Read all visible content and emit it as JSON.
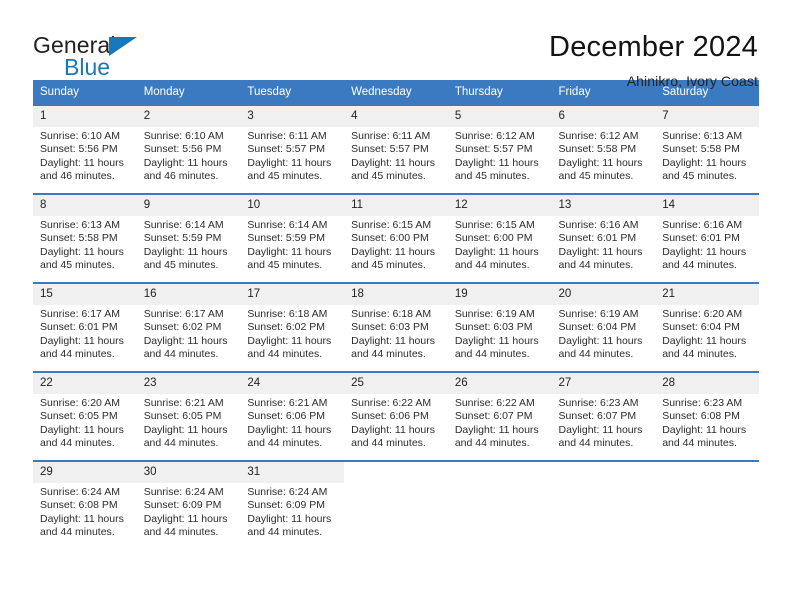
{
  "brand": {
    "name_part1": "General",
    "name_part2": "Blue",
    "accent_color": "#1878be"
  },
  "header": {
    "title": "December 2024",
    "subtitle": "Ahinikro, Ivory Coast"
  },
  "calendar": {
    "header_bg": "#3b7ac1",
    "daynum_bg": "#f0f0f0",
    "weekdays": [
      "Sunday",
      "Monday",
      "Tuesday",
      "Wednesday",
      "Thursday",
      "Friday",
      "Saturday"
    ],
    "weeks": [
      [
        {
          "day": "1",
          "sunrise": "Sunrise: 6:10 AM",
          "sunset": "Sunset: 5:56 PM",
          "daylight_1": "Daylight: 11 hours",
          "daylight_2": "and 46 minutes."
        },
        {
          "day": "2",
          "sunrise": "Sunrise: 6:10 AM",
          "sunset": "Sunset: 5:56 PM",
          "daylight_1": "Daylight: 11 hours",
          "daylight_2": "and 46 minutes."
        },
        {
          "day": "3",
          "sunrise": "Sunrise: 6:11 AM",
          "sunset": "Sunset: 5:57 PM",
          "daylight_1": "Daylight: 11 hours",
          "daylight_2": "and 45 minutes."
        },
        {
          "day": "4",
          "sunrise": "Sunrise: 6:11 AM",
          "sunset": "Sunset: 5:57 PM",
          "daylight_1": "Daylight: 11 hours",
          "daylight_2": "and 45 minutes."
        },
        {
          "day": "5",
          "sunrise": "Sunrise: 6:12 AM",
          "sunset": "Sunset: 5:57 PM",
          "daylight_1": "Daylight: 11 hours",
          "daylight_2": "and 45 minutes."
        },
        {
          "day": "6",
          "sunrise": "Sunrise: 6:12 AM",
          "sunset": "Sunset: 5:58 PM",
          "daylight_1": "Daylight: 11 hours",
          "daylight_2": "and 45 minutes."
        },
        {
          "day": "7",
          "sunrise": "Sunrise: 6:13 AM",
          "sunset": "Sunset: 5:58 PM",
          "daylight_1": "Daylight: 11 hours",
          "daylight_2": "and 45 minutes."
        }
      ],
      [
        {
          "day": "8",
          "sunrise": "Sunrise: 6:13 AM",
          "sunset": "Sunset: 5:58 PM",
          "daylight_1": "Daylight: 11 hours",
          "daylight_2": "and 45 minutes."
        },
        {
          "day": "9",
          "sunrise": "Sunrise: 6:14 AM",
          "sunset": "Sunset: 5:59 PM",
          "daylight_1": "Daylight: 11 hours",
          "daylight_2": "and 45 minutes."
        },
        {
          "day": "10",
          "sunrise": "Sunrise: 6:14 AM",
          "sunset": "Sunset: 5:59 PM",
          "daylight_1": "Daylight: 11 hours",
          "daylight_2": "and 45 minutes."
        },
        {
          "day": "11",
          "sunrise": "Sunrise: 6:15 AM",
          "sunset": "Sunset: 6:00 PM",
          "daylight_1": "Daylight: 11 hours",
          "daylight_2": "and 45 minutes."
        },
        {
          "day": "12",
          "sunrise": "Sunrise: 6:15 AM",
          "sunset": "Sunset: 6:00 PM",
          "daylight_1": "Daylight: 11 hours",
          "daylight_2": "and 44 minutes."
        },
        {
          "day": "13",
          "sunrise": "Sunrise: 6:16 AM",
          "sunset": "Sunset: 6:01 PM",
          "daylight_1": "Daylight: 11 hours",
          "daylight_2": "and 44 minutes."
        },
        {
          "day": "14",
          "sunrise": "Sunrise: 6:16 AM",
          "sunset": "Sunset: 6:01 PM",
          "daylight_1": "Daylight: 11 hours",
          "daylight_2": "and 44 minutes."
        }
      ],
      [
        {
          "day": "15",
          "sunrise": "Sunrise: 6:17 AM",
          "sunset": "Sunset: 6:01 PM",
          "daylight_1": "Daylight: 11 hours",
          "daylight_2": "and 44 minutes."
        },
        {
          "day": "16",
          "sunrise": "Sunrise: 6:17 AM",
          "sunset": "Sunset: 6:02 PM",
          "daylight_1": "Daylight: 11 hours",
          "daylight_2": "and 44 minutes."
        },
        {
          "day": "17",
          "sunrise": "Sunrise: 6:18 AM",
          "sunset": "Sunset: 6:02 PM",
          "daylight_1": "Daylight: 11 hours",
          "daylight_2": "and 44 minutes."
        },
        {
          "day": "18",
          "sunrise": "Sunrise: 6:18 AM",
          "sunset": "Sunset: 6:03 PM",
          "daylight_1": "Daylight: 11 hours",
          "daylight_2": "and 44 minutes."
        },
        {
          "day": "19",
          "sunrise": "Sunrise: 6:19 AM",
          "sunset": "Sunset: 6:03 PM",
          "daylight_1": "Daylight: 11 hours",
          "daylight_2": "and 44 minutes."
        },
        {
          "day": "20",
          "sunrise": "Sunrise: 6:19 AM",
          "sunset": "Sunset: 6:04 PM",
          "daylight_1": "Daylight: 11 hours",
          "daylight_2": "and 44 minutes."
        },
        {
          "day": "21",
          "sunrise": "Sunrise: 6:20 AM",
          "sunset": "Sunset: 6:04 PM",
          "daylight_1": "Daylight: 11 hours",
          "daylight_2": "and 44 minutes."
        }
      ],
      [
        {
          "day": "22",
          "sunrise": "Sunrise: 6:20 AM",
          "sunset": "Sunset: 6:05 PM",
          "daylight_1": "Daylight: 11 hours",
          "daylight_2": "and 44 minutes."
        },
        {
          "day": "23",
          "sunrise": "Sunrise: 6:21 AM",
          "sunset": "Sunset: 6:05 PM",
          "daylight_1": "Daylight: 11 hours",
          "daylight_2": "and 44 minutes."
        },
        {
          "day": "24",
          "sunrise": "Sunrise: 6:21 AM",
          "sunset": "Sunset: 6:06 PM",
          "daylight_1": "Daylight: 11 hours",
          "daylight_2": "and 44 minutes."
        },
        {
          "day": "25",
          "sunrise": "Sunrise: 6:22 AM",
          "sunset": "Sunset: 6:06 PM",
          "daylight_1": "Daylight: 11 hours",
          "daylight_2": "and 44 minutes."
        },
        {
          "day": "26",
          "sunrise": "Sunrise: 6:22 AM",
          "sunset": "Sunset: 6:07 PM",
          "daylight_1": "Daylight: 11 hours",
          "daylight_2": "and 44 minutes."
        },
        {
          "day": "27",
          "sunrise": "Sunrise: 6:23 AM",
          "sunset": "Sunset: 6:07 PM",
          "daylight_1": "Daylight: 11 hours",
          "daylight_2": "and 44 minutes."
        },
        {
          "day": "28",
          "sunrise": "Sunrise: 6:23 AM",
          "sunset": "Sunset: 6:08 PM",
          "daylight_1": "Daylight: 11 hours",
          "daylight_2": "and 44 minutes."
        }
      ],
      [
        {
          "day": "29",
          "sunrise": "Sunrise: 6:24 AM",
          "sunset": "Sunset: 6:08 PM",
          "daylight_1": "Daylight: 11 hours",
          "daylight_2": "and 44 minutes."
        },
        {
          "day": "30",
          "sunrise": "Sunrise: 6:24 AM",
          "sunset": "Sunset: 6:09 PM",
          "daylight_1": "Daylight: 11 hours",
          "daylight_2": "and 44 minutes."
        },
        {
          "day": "31",
          "sunrise": "Sunrise: 6:24 AM",
          "sunset": "Sunset: 6:09 PM",
          "daylight_1": "Daylight: 11 hours",
          "daylight_2": "and 44 minutes."
        },
        {
          "day": "",
          "sunrise": "",
          "sunset": "",
          "daylight_1": "",
          "daylight_2": ""
        },
        {
          "day": "",
          "sunrise": "",
          "sunset": "",
          "daylight_1": "",
          "daylight_2": ""
        },
        {
          "day": "",
          "sunrise": "",
          "sunset": "",
          "daylight_1": "",
          "daylight_2": ""
        },
        {
          "day": "",
          "sunrise": "",
          "sunset": "",
          "daylight_1": "",
          "daylight_2": ""
        }
      ]
    ]
  }
}
